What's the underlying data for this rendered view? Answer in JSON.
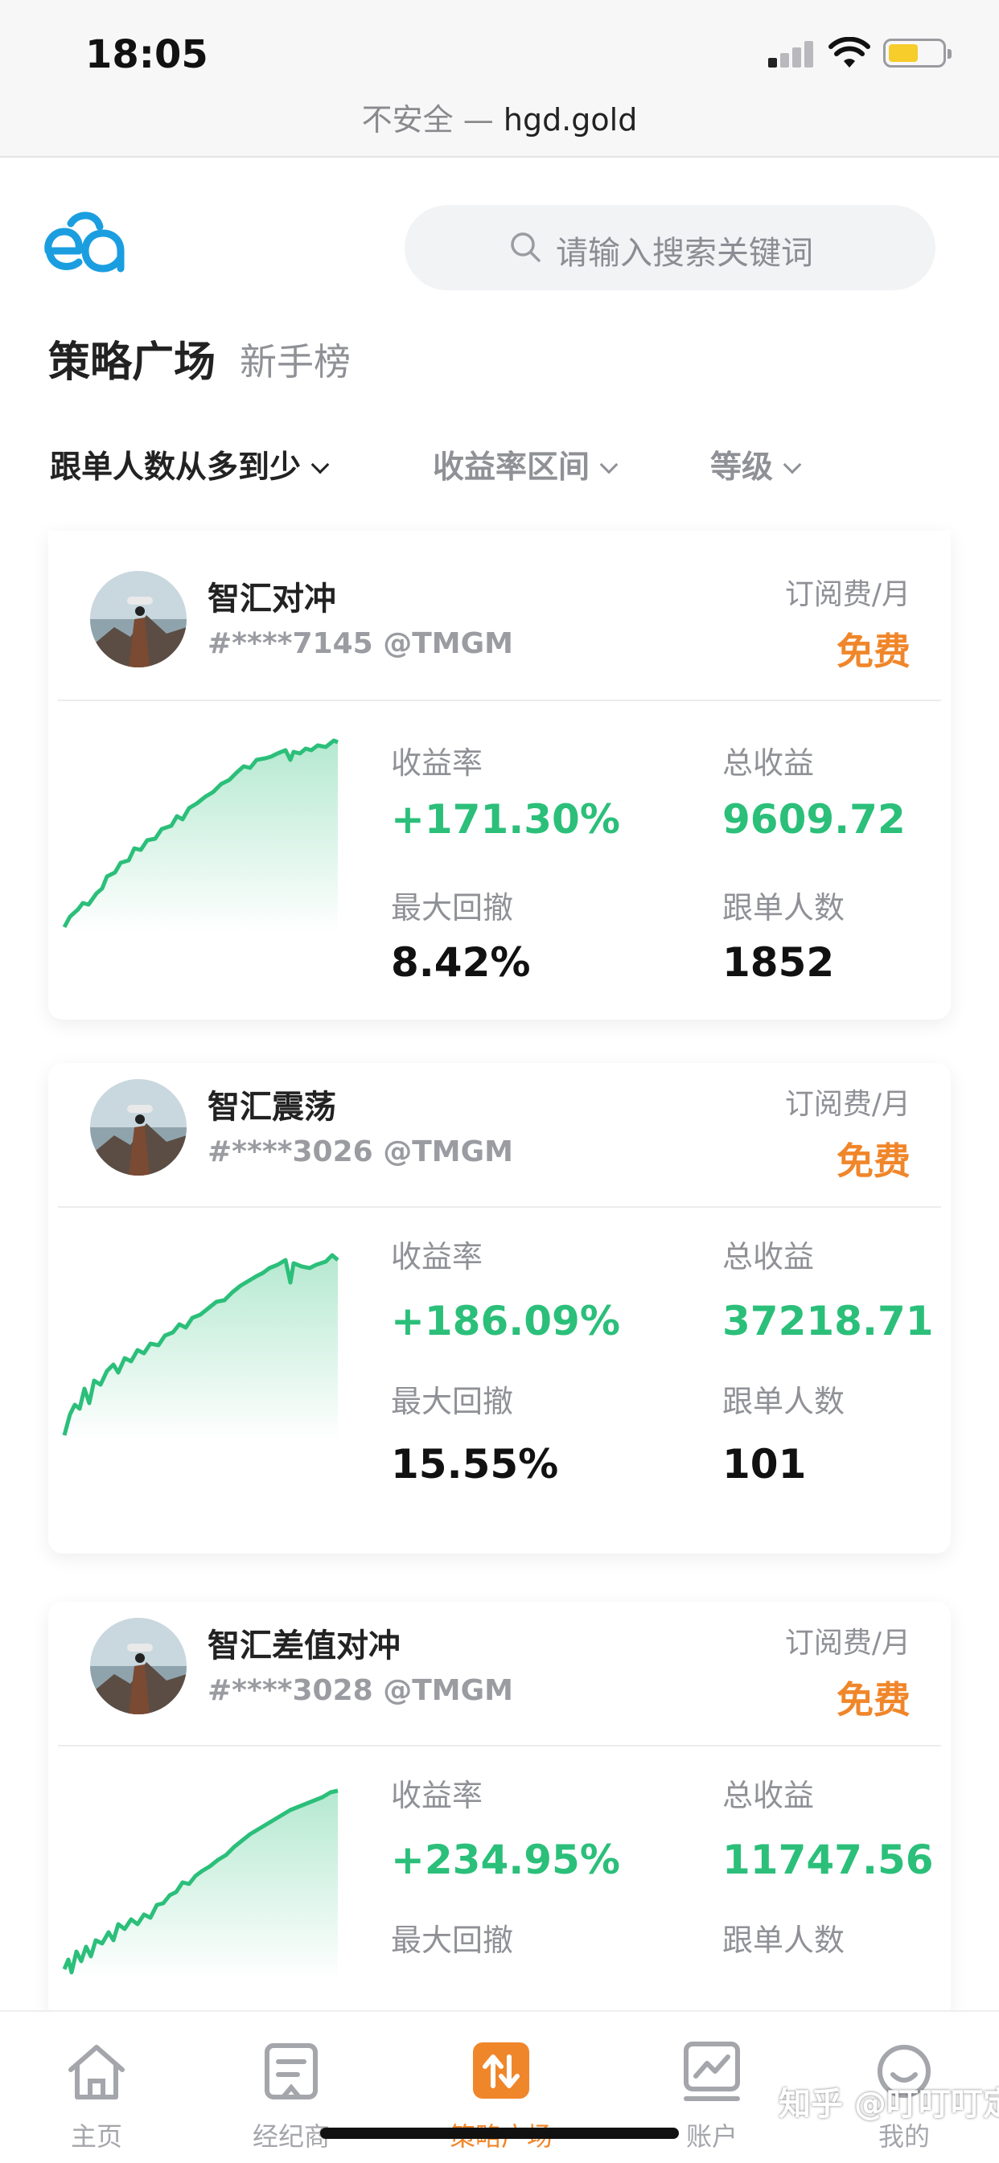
{
  "status_bar": {
    "time": "18:05",
    "url_insecure": "不安全 —",
    "url_domain": "hgd.gold"
  },
  "header": {
    "logo": "ea-logo",
    "search_placeholder": "请输入搜索关键词",
    "tabs": [
      {
        "label": "策略广场",
        "active": true
      },
      {
        "label": "新手榜",
        "active": false
      }
    ],
    "filters": [
      {
        "label": "跟单人数从多到少",
        "active": true
      },
      {
        "label": "收益率区间",
        "active": false
      },
      {
        "label": "等级",
        "active": false
      }
    ]
  },
  "strategies": [
    {
      "name": "智汇对冲",
      "id": "#****7145 @TMGM",
      "fee_label": "订阅费/月",
      "fee": "免费",
      "return_label": "收益率",
      "return_value": "+171.30%",
      "profit_label": "总收益",
      "profit_value": "9609.72",
      "drawdown_label": "最大回撤",
      "drawdown_value": "8.42%",
      "followers_label": "跟单人数",
      "followers_value": "1852"
    },
    {
      "name": "智汇震荡",
      "id": "#****3026 @TMGM",
      "fee_label": "订阅费/月",
      "fee": "免费",
      "return_label": "收益率",
      "return_value": "+186.09%",
      "profit_label": "总收益",
      "profit_value": "37218.71",
      "drawdown_label": "最大回撤",
      "drawdown_value": "15.55%",
      "followers_label": "跟单人数",
      "followers_value": "101"
    },
    {
      "name": "智汇差值对冲",
      "id": "#****3028 @TMGM",
      "fee_label": "订阅费/月",
      "fee": "免费",
      "return_label": "收益率",
      "return_value": "+234.95%",
      "profit_label": "总收益",
      "profit_value": "11747.56",
      "drawdown_label": "最大回撤",
      "drawdown_value": "",
      "followers_label": "跟单人数",
      "followers_value": ""
    }
  ],
  "tab_bar": [
    {
      "label": "主页",
      "icon": "home-icon",
      "active": false
    },
    {
      "label": "经纪商",
      "icon": "broker-icon",
      "active": false
    },
    {
      "label": "策略广场",
      "icon": "swap-icon",
      "active": true
    },
    {
      "label": "账户",
      "icon": "chart-icon",
      "active": false
    },
    {
      "label": "我的",
      "icon": "smile-icon",
      "active": false
    }
  ],
  "watermark": "知乎 @叮叮叮定",
  "colors": {
    "accent": "#f0862a",
    "positive": "#2bbf7a",
    "logo": "#1a9ee0",
    "muted": "#8f9196"
  }
}
